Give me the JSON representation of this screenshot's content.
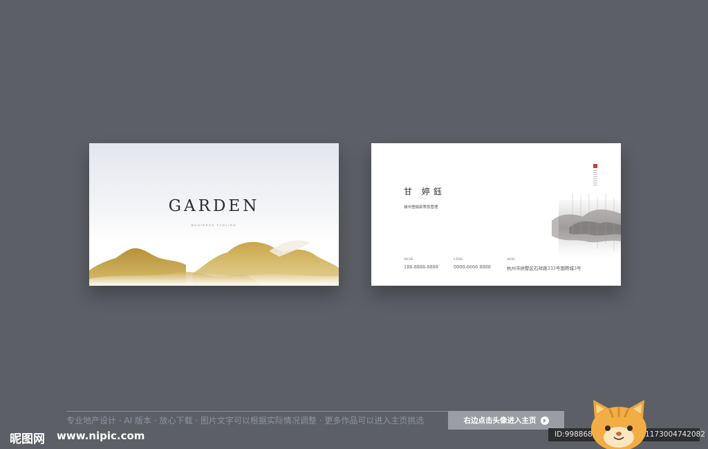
{
  "front_card": {
    "title": "GARDEN",
    "tagline": "BUSINESS TAGLINE"
  },
  "back_card": {
    "name": "甘 婷鈺",
    "job_title": "城市營銷部策划管理",
    "contacts": [
      {
        "label": "MOB.",
        "value": "188-8888-8888"
      },
      {
        "label": "LINE.",
        "value": "0000-6666 8888"
      },
      {
        "label": "ADD.",
        "value": "杭州市拱墅区石祥路333号国際城3号"
      }
    ]
  },
  "bottom_bar": {
    "description": "专业地产设计 · AI 版本 · 放心下载 · 图片文字可以根据实际情况调整 · 更多作品可以进入主页挑选",
    "enter_button": "右边点击头像进入主页"
  },
  "site": {
    "logo": "昵图网",
    "url": "www.nipic.com",
    "id_text": "ID:9988686 NO:20220831173004742082"
  },
  "colors": {
    "background": "#5c6066",
    "gold": "#c9a64a",
    "seal_red": "#c7403a"
  },
  "icons": [
    "arrow-right-circle-icon",
    "cat-avatar-icon",
    "seal-stamp-icon"
  ]
}
